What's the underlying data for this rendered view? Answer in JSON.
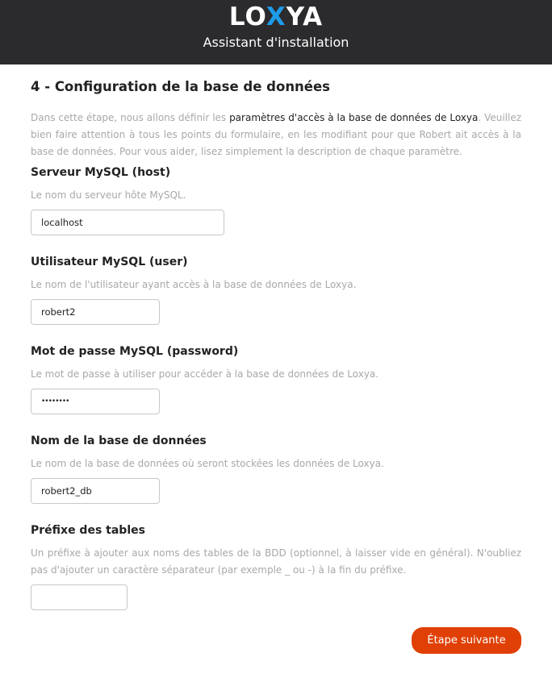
{
  "header": {
    "logo_pre": "LO",
    "logo_x": "X",
    "logo_post": "YA",
    "subtitle": "Assistant d'installation"
  },
  "title": "4 - Configuration de la base de données",
  "intro": {
    "pre": "Dans cette étape, nous allons définir les ",
    "bold": "paramètres d'accès à la base de données de Loxya",
    "post": ". Veuillez bien faire attention à tous les points du formulaire, en les modifiant pour que Robert ait accès à la base de données. Pour vous aider, lisez simplement la description de chaque paramètre."
  },
  "fields": [
    {
      "label": "Serveur MySQL (host)",
      "description": "Le nom du serveur hôte MySQL.",
      "value": "localhost"
    },
    {
      "label": "Utilisateur MySQL (user)",
      "description": "Le nom de l'utilisateur ayant accès à la base de données de Loxya.",
      "value": "robert2"
    },
    {
      "label": "Mot de passe MySQL (password)",
      "description": "Le mot de passe à utiliser pour accéder à la base de données de Loxya.",
      "value": "••••••••"
    },
    {
      "label": "Nom de la base de données",
      "description": "Le nom de la base de données où seront stockées les données de Loxya.",
      "value": "robert2_db"
    },
    {
      "label": "Préfixe des tables",
      "description": "Un préfixe à ajouter aux noms des tables de la BDD (optionnel, à laisser vide en général). N'oubliez pas d'ajouter un caractère séparateur (par exemple _ ou -) à la fin du préfixe.",
      "value": ""
    }
  ],
  "next_button": "Étape suivante",
  "colors": {
    "header": "#2b2a2d",
    "accent": "#e04006",
    "logo_x": "#1e9be9"
  }
}
